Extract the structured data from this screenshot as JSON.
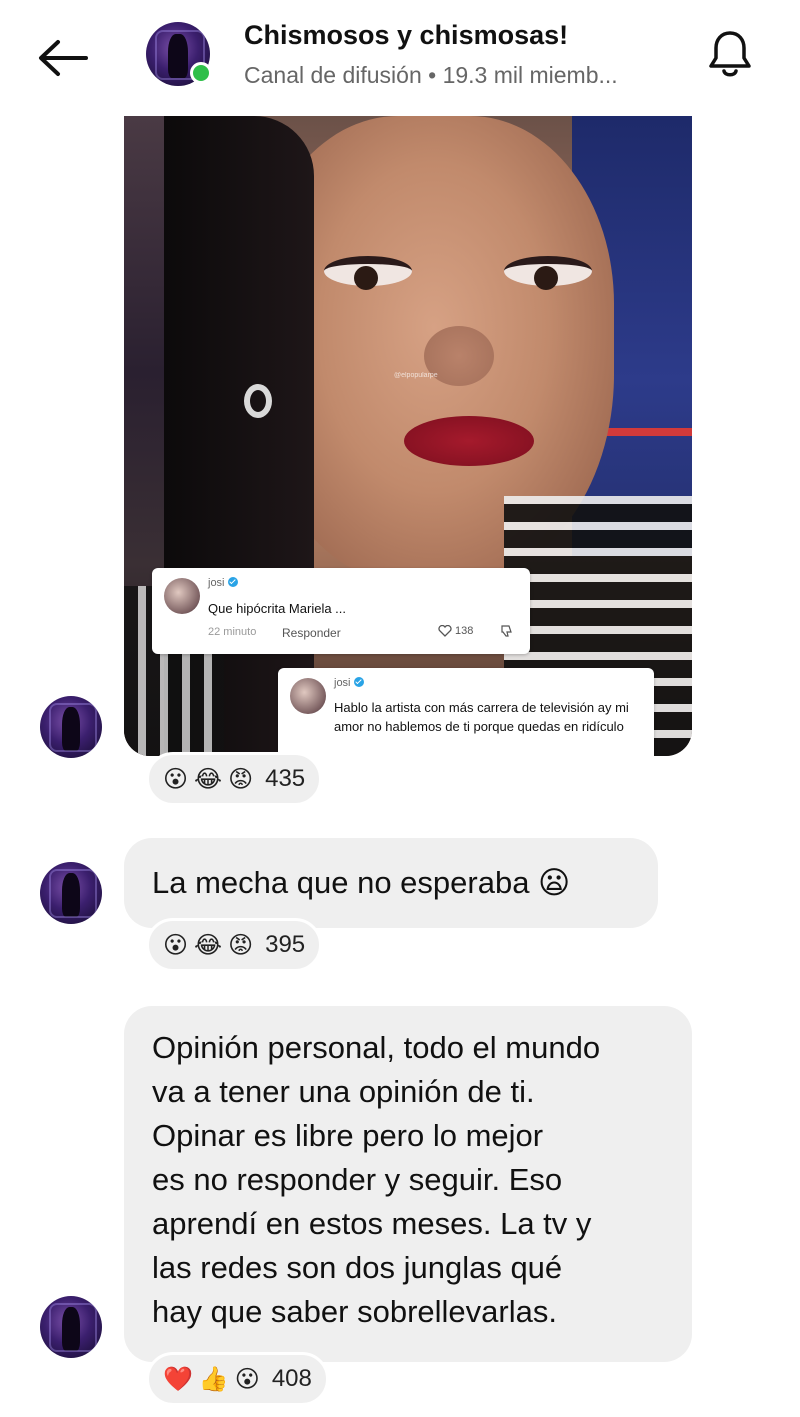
{
  "header": {
    "back_icon": "arrow-left-icon",
    "channel_name": "Chismosos y chismosas!",
    "channel_subtitle": "Canal de difusión • 19.3 mil miemb...",
    "bell_icon": "bell-icon"
  },
  "media_post": {
    "watermark": "@elpopularpe",
    "comments": [
      {
        "user": "josi",
        "text": "Que hipócrita Mariela ...",
        "time": "22 minuto",
        "reply_label": "Responder",
        "likes": "138"
      },
      {
        "user": "josi",
        "text": "Hablo la artista con más carrera de televisión ay mi amor no hablemos de ti porque quedas en ridículo"
      }
    ],
    "reactions": {
      "emojis": [
        "😮",
        "😂",
        "😡"
      ],
      "count": "435"
    }
  },
  "messages": [
    {
      "text": "La mecha que no esperaba 😦",
      "reactions": {
        "emojis": [
          "😮",
          "😂",
          "😡"
        ],
        "count": "395"
      }
    },
    {
      "lines": [
        "Opinión personal, todo el mundo",
        "va a tener una opinión de ti.",
        "Opinar es libre pero lo mejor",
        "es no responder y seguir. Eso",
        "aprendí en estos meses. La tv y",
        "las redes son dos junglas qué",
        "hay que saber sobrellevarlas."
      ],
      "reactions": {
        "emojis": [
          "❤️",
          "👍",
          "😮"
        ],
        "count": "408"
      }
    }
  ],
  "colors": {
    "online": "#2fbf4a",
    "bubble": "#efefef",
    "verified": "#29a3e6"
  }
}
